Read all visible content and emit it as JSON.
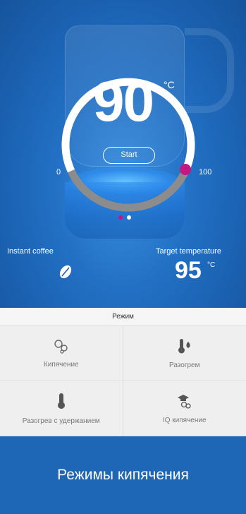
{
  "dial": {
    "temperature": "90",
    "unit": "°C",
    "start_label": "Start",
    "scale_min": "0",
    "scale_max": "100",
    "level": 0.9,
    "colors": {
      "ring": "#ffffff",
      "track": "#8c8c8c",
      "knob": "#c2187f"
    }
  },
  "pager": {
    "current": 1,
    "total": 2
  },
  "info": {
    "left_label": "Instant coffee",
    "right_label": "Target temperature",
    "target_value": "95",
    "target_unit": "°C",
    "left_icon": "coffee-bean-icon"
  },
  "modes": {
    "title": "Режим",
    "items": [
      {
        "label": "Кипячение",
        "icon": "bubbles-icon"
      },
      {
        "label": "Разогрем",
        "icon": "thermometer-flame-icon"
      },
      {
        "label": "Разогрев с удержанием",
        "icon": "thermometer-icon"
      },
      {
        "label": "IQ кипячение",
        "icon": "graduation-cap-bubbles-icon"
      }
    ]
  },
  "footer": {
    "title": "Режимы кипячения"
  },
  "colors": {
    "brand_blue": "#1e67b6",
    "accent_magenta": "#c2187f"
  }
}
